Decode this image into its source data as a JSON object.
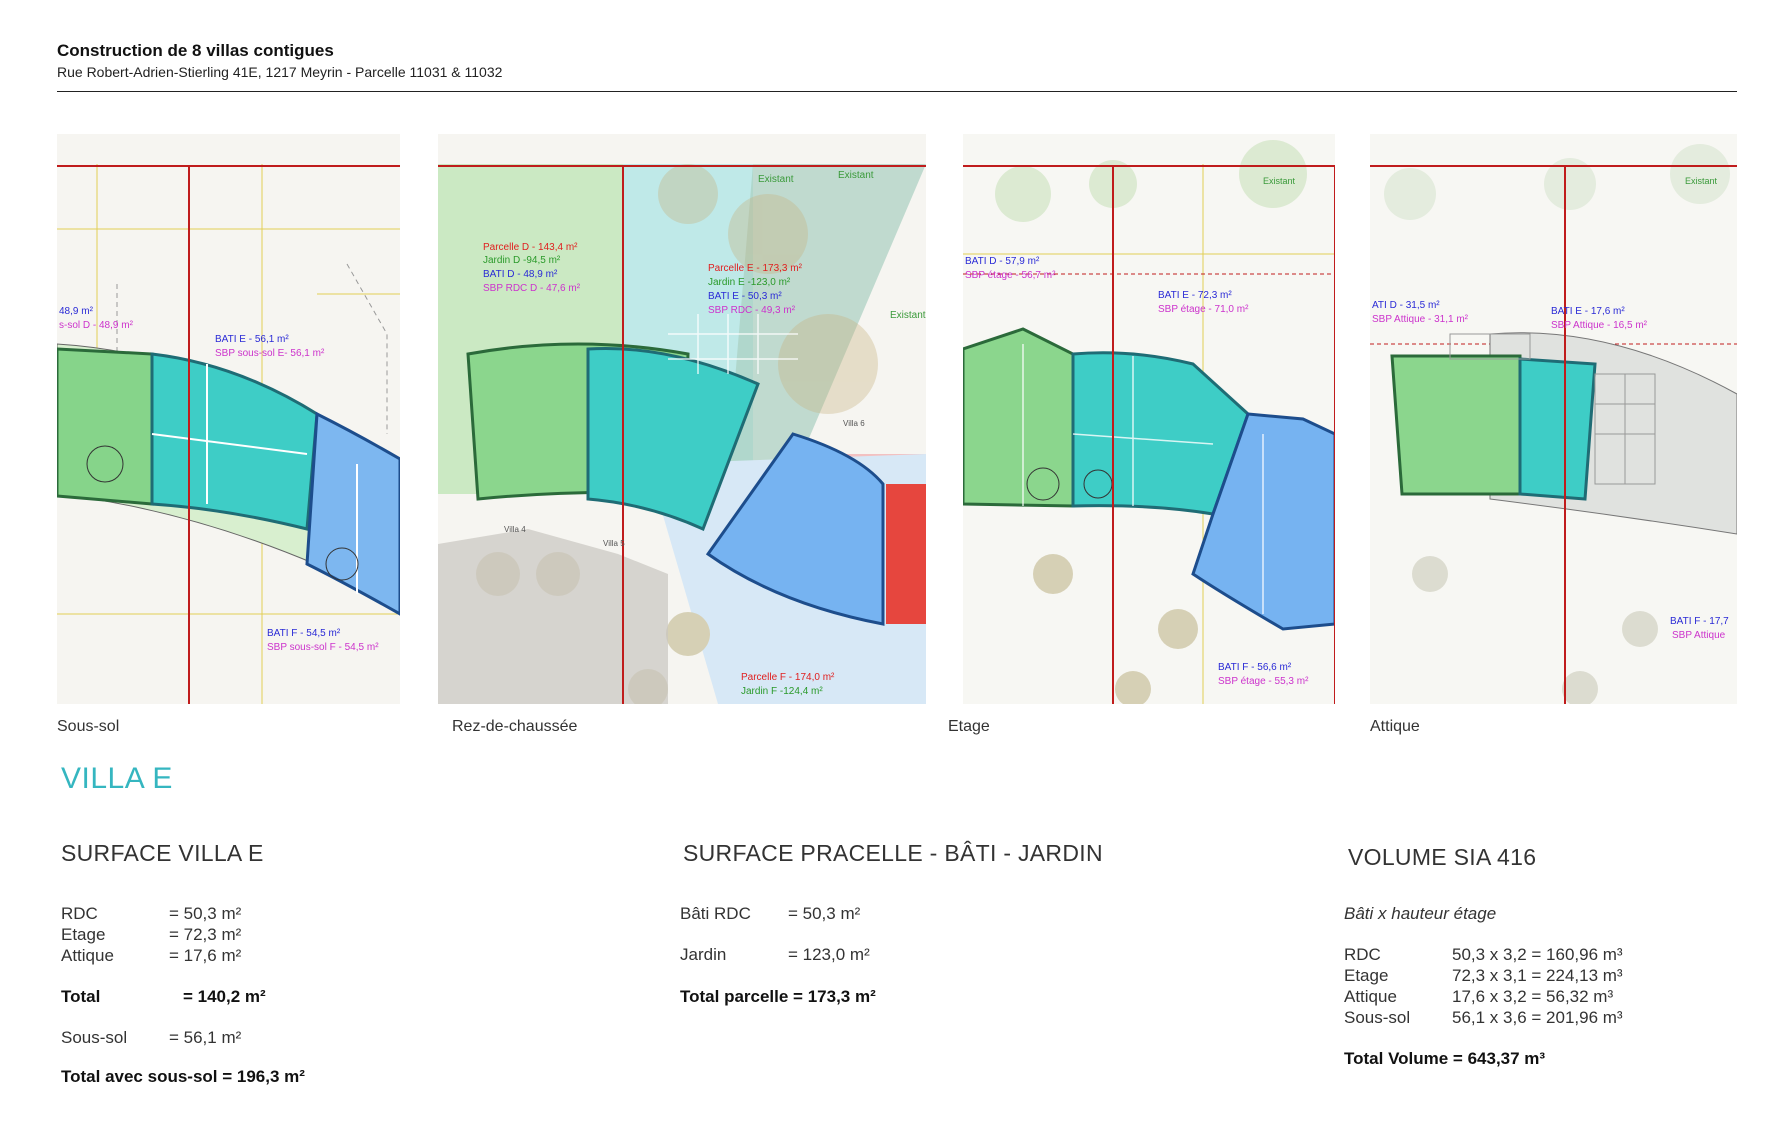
{
  "header": {
    "title": "Construction de 8 villas contigues",
    "subtitle": "Rue Robert-Adrien-Stierling 41E, 1217 Meyrin - Parcelle 11031 & 11032"
  },
  "plans": [
    {
      "caption": "Sous-sol",
      "labels": [
        {
          "text": "48,9 m²",
          "color": "#2a2ad6"
        },
        {
          "text": "s-sol D - 48,9 m²",
          "color": "#cc33cc"
        },
        {
          "text": "BATI E - 56,1 m²",
          "color": "#2a2ad6"
        },
        {
          "text": "SBP sous-sol  E- 56,1 m²",
          "color": "#cc33cc"
        },
        {
          "text": "BATI F - 54,5 m²",
          "color": "#2a2ad6"
        },
        {
          "text": "SBP sous-sol F - 54,5 m²",
          "color": "#cc33cc"
        }
      ]
    },
    {
      "caption": "Rez-de-chaussée",
      "labels": [
        {
          "text": "Parcelle D - 143,4 m²",
          "color": "#e02020"
        },
        {
          "text": "Jardin D -94,5 m²",
          "color": "#2a9a2a"
        },
        {
          "text": "BATI D - 48,9 m²",
          "color": "#2a2ad6"
        },
        {
          "text": "SBP RDC D - 47,6 m²",
          "color": "#cc33cc"
        },
        {
          "text": "Parcelle E - 173,3 m²",
          "color": "#e02020"
        },
        {
          "text": "Jardin E -123,0 m²",
          "color": "#2a9a2a"
        },
        {
          "text": "BATI E - 50,3 m²",
          "color": "#2a2ad6"
        },
        {
          "text": "SBP RDC - 49,3 m²",
          "color": "#cc33cc"
        },
        {
          "text": "Parcelle F - 174,0 m²",
          "color": "#e02020"
        },
        {
          "text": "Jardin F -124,4 m²",
          "color": "#2a9a2a"
        },
        {
          "text": "Existant",
          "color": "#3a9a3a"
        },
        {
          "text": "Existant",
          "color": "#3a9a3a"
        },
        {
          "text": "Existant",
          "color": "#3a9a3a"
        },
        {
          "text": "Villa 4",
          "color": "#555555"
        },
        {
          "text": "Villa 5",
          "color": "#555555"
        },
        {
          "text": "Villa 6",
          "color": "#555555"
        }
      ]
    },
    {
      "caption": "Etage",
      "labels": [
        {
          "text": "BATI D - 57,9 m²",
          "color": "#2a2ad6"
        },
        {
          "text": "SBP étage - 56,7 m²",
          "color": "#cc33cc"
        },
        {
          "text": "BATI E - 72,3 m²",
          "color": "#2a2ad6"
        },
        {
          "text": "SBP étage - 71,0 m²",
          "color": "#cc33cc"
        },
        {
          "text": "BATI F - 56,6 m²",
          "color": "#2a2ad6"
        },
        {
          "text": "SBP étage - 55,3 m²",
          "color": "#cc33cc"
        },
        {
          "text": "Existant",
          "color": "#3a9a3a"
        }
      ]
    },
    {
      "caption": "Attique",
      "labels": [
        {
          "text": "ATI D - 31,5 m²",
          "color": "#2a2ad6"
        },
        {
          "text": "SBP Attique - 31,1 m²",
          "color": "#cc33cc"
        },
        {
          "text": "BATI E - 17,6 m²",
          "color": "#2a2ad6"
        },
        {
          "text": "SBP Attique - 16,5 m²",
          "color": "#cc33cc"
        },
        {
          "text": "BATI F - 17,7",
          "color": "#2a2ad6"
        },
        {
          "text": "SBP Attique",
          "color": "#cc33cc"
        },
        {
          "text": "Existant",
          "color": "#3a9a3a"
        }
      ]
    }
  ],
  "villa_title": "VILLA E",
  "surface_villa": {
    "title": "SURFACE VILLA E",
    "rows": [
      {
        "label": "RDC",
        "value": "= 50,3 m²"
      },
      {
        "label": "Etage",
        "value": "= 72,3 m²"
      },
      {
        "label": "Attique",
        "value": "= 17,6 m²"
      }
    ],
    "total_label": "Total",
    "total_value": "= 140,2 m²",
    "soussol_label": "Sous-sol",
    "soussol_value": "= 56,1 m²",
    "grand_total": "Total avec sous-sol  = 196,3 m²"
  },
  "surface_parcelle": {
    "title": "SURFACE PRACELLE - BÂTI - JARDIN",
    "rows": [
      {
        "label": "Bâti RDC",
        "value": "= 50,3 m²"
      },
      {
        "label": "Jardin",
        "value": "= 123,0  m²"
      }
    ],
    "total": "Total parcelle = 173,3 m²"
  },
  "volume": {
    "title": "VOLUME SIA 416",
    "subtitle": "Bâti x hauteur étage",
    "rows": [
      {
        "label": "RDC",
        "value": "50,3 x 3,2 = 160,96 m³"
      },
      {
        "label": "Etage",
        "value": "72,3 x 3,1 = 224,13 m³"
      },
      {
        "label": "Attique",
        "value": "17,6 x 3,2 = 56,32 m³"
      },
      {
        "label": "Sous-sol",
        "value": "56,1 x 3,6 = 201,96 m³"
      }
    ],
    "total": "Total Volume = 643,37 m³"
  },
  "colors": {
    "accent": "#35b6c0",
    "villa_d": "#8fd68a",
    "villa_e": "#48d3cf",
    "villa_f": "#7fb7f2",
    "boundary": "#b01c1c"
  }
}
